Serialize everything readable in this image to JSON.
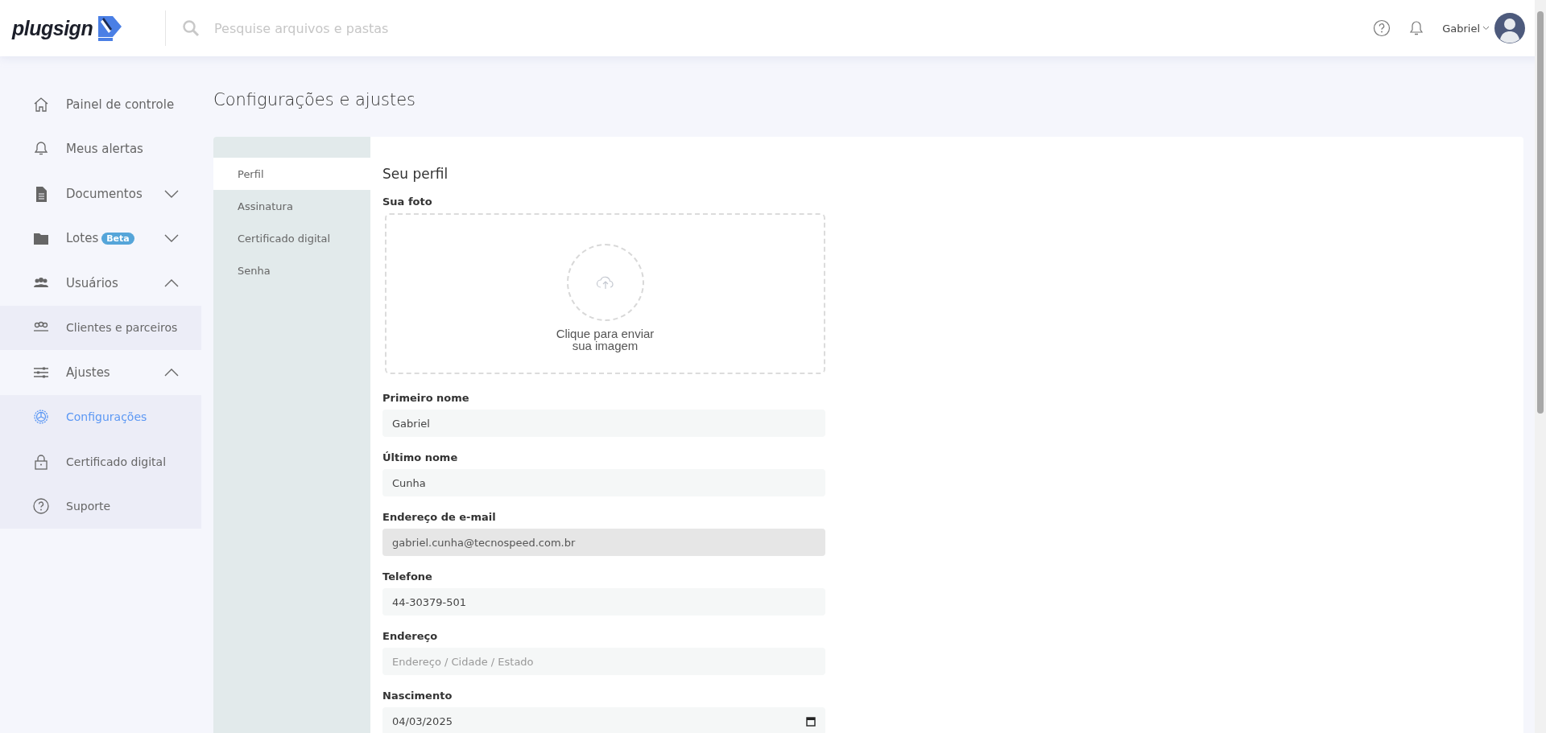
{
  "header": {
    "logo": "plugsign",
    "search": {
      "placeholder": "Pesquise arquivos e pastas"
    },
    "user": {
      "name": "Gabriel"
    }
  },
  "sidebar": {
    "items": [
      {
        "label": "Painel de controle",
        "selected": false
      },
      {
        "label": "Meus alertas",
        "selected": false
      },
      {
        "label": "Documentos",
        "selected": false,
        "expanded": false
      },
      {
        "label": "Lotes",
        "badge": "Beta",
        "selected": false,
        "expanded": false
      },
      {
        "label": "Usuários",
        "selected": false,
        "expanded": true,
        "children": [
          {
            "label": "Clientes e parceiros",
            "selected": false
          }
        ]
      },
      {
        "label": "Ajustes",
        "selected": false,
        "expanded": true,
        "children": [
          {
            "label": "Configurações",
            "selected": true
          },
          {
            "label": "Certificado digital",
            "selected": false
          },
          {
            "label": "Suporte",
            "selected": false
          }
        ]
      }
    ]
  },
  "page_title": "Configurações e ajustes",
  "tabs": [
    {
      "label": "Perfil",
      "selected": true
    },
    {
      "label": "Assinatura",
      "selected": false
    },
    {
      "label": "Certificado digital",
      "selected": false
    },
    {
      "label": "Senha",
      "selected": false
    }
  ],
  "profile": {
    "title": "Seu perfil",
    "photo_label": "Sua foto",
    "upload_text": "Clique para enviar sua imagem",
    "fields": [
      {
        "label": "Primeiro nome",
        "kind": "text",
        "value": "Gabriel",
        "disabled": false
      },
      {
        "label": "Último nome",
        "kind": "text",
        "value": "Cunha",
        "disabled": false
      },
      {
        "label": "Endereço de e-mail",
        "kind": "text",
        "value": "gabriel.cunha@tecnospeed.com.br",
        "disabled": true
      },
      {
        "label": "Telefone",
        "kind": "text",
        "value": "44-30379-501",
        "disabled": false
      },
      {
        "label": "Endereço",
        "kind": "text",
        "placeholder": "Endereço / Cidade / Estado",
        "disabled": false
      },
      {
        "label": "Nascimento",
        "kind": "date",
        "value": "04/03/2025",
        "disabled": false
      }
    ]
  }
}
